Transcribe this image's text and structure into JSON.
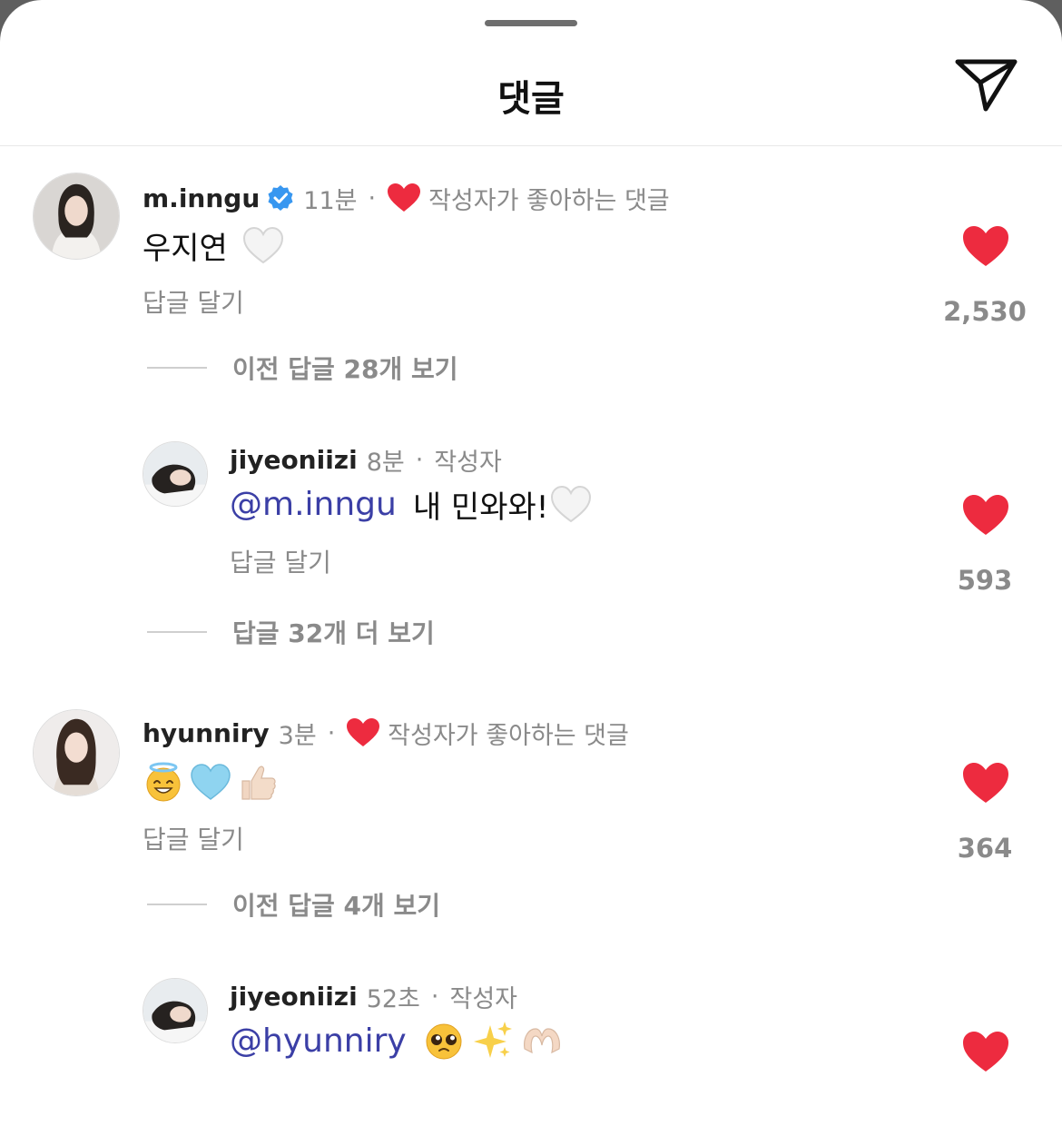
{
  "header": {
    "title": "댓글",
    "share_icon": "send-icon"
  },
  "colors": {
    "heart": "#ed2b3f",
    "mention": "#3b3fa6",
    "verified": "#3897f0"
  },
  "comments": [
    {
      "username": "m.inngu",
      "verified": true,
      "time": "11분",
      "liked_by_author_label": "작성자가 좋아하는 댓글",
      "text": "우지연",
      "emojis": [
        "white-heart-icon"
      ],
      "reply_label": "답글 달기",
      "like_count": "2,530",
      "more_replies": "이전 답글 28개 보기"
    },
    {
      "username": "jiyeoniizi",
      "time": "8분",
      "author_label": "작성자",
      "mention": "@m.inngu",
      "text": "내 민와와!",
      "emojis": [
        "white-heart-icon"
      ],
      "reply_label": "답글 달기",
      "like_count": "593",
      "more_replies": "답글 32개 더 보기"
    },
    {
      "username": "hyunniry",
      "time": "3분",
      "liked_by_author_label": "작성자가 좋아하는 댓글",
      "emojis": [
        "smiling-halo-face-icon",
        "light-blue-heart-icon",
        "thumbs-up-icon"
      ],
      "reply_label": "답글 달기",
      "like_count": "364",
      "more_replies": "이전 답글 4개 보기"
    },
    {
      "username": "jiyeoniizi",
      "time": "52초",
      "author_label": "작성자",
      "mention": "@hyunniry",
      "emojis": [
        "pleading-face-icon",
        "sparkles-icon",
        "heart-hands-icon"
      ]
    }
  ]
}
